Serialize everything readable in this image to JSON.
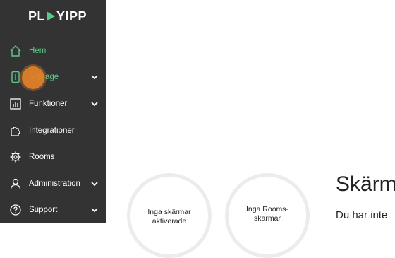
{
  "app": {
    "logo_text": "PLAYIPP"
  },
  "sidebar": {
    "items": [
      {
        "label": "Hem",
        "icon": "home-icon",
        "active": true
      },
      {
        "label": "Signage",
        "icon": "display-icon",
        "active": true,
        "expandable": true
      },
      {
        "label": "Funktioner",
        "icon": "chart-icon",
        "expandable": true
      },
      {
        "label": "Integrationer",
        "icon": "puzzle-icon"
      },
      {
        "label": "Rooms",
        "icon": "gear-icon"
      },
      {
        "label": "Administration",
        "icon": "user-icon",
        "expandable": true
      },
      {
        "label": "Support",
        "icon": "help-icon",
        "expandable": true
      }
    ]
  },
  "main": {
    "cards": [
      {
        "text_line1": "Inga skärmar",
        "text_line2": "aktiverade"
      },
      {
        "text_line1": "Inga Rooms-",
        "text_line2": "skärmar"
      }
    ],
    "heading": "Skärm",
    "subtext": "Du har inte"
  },
  "colors": {
    "sidebar_bg": "#333333",
    "active_green": "#5cc98a",
    "cursor_orange": "#e68228"
  }
}
